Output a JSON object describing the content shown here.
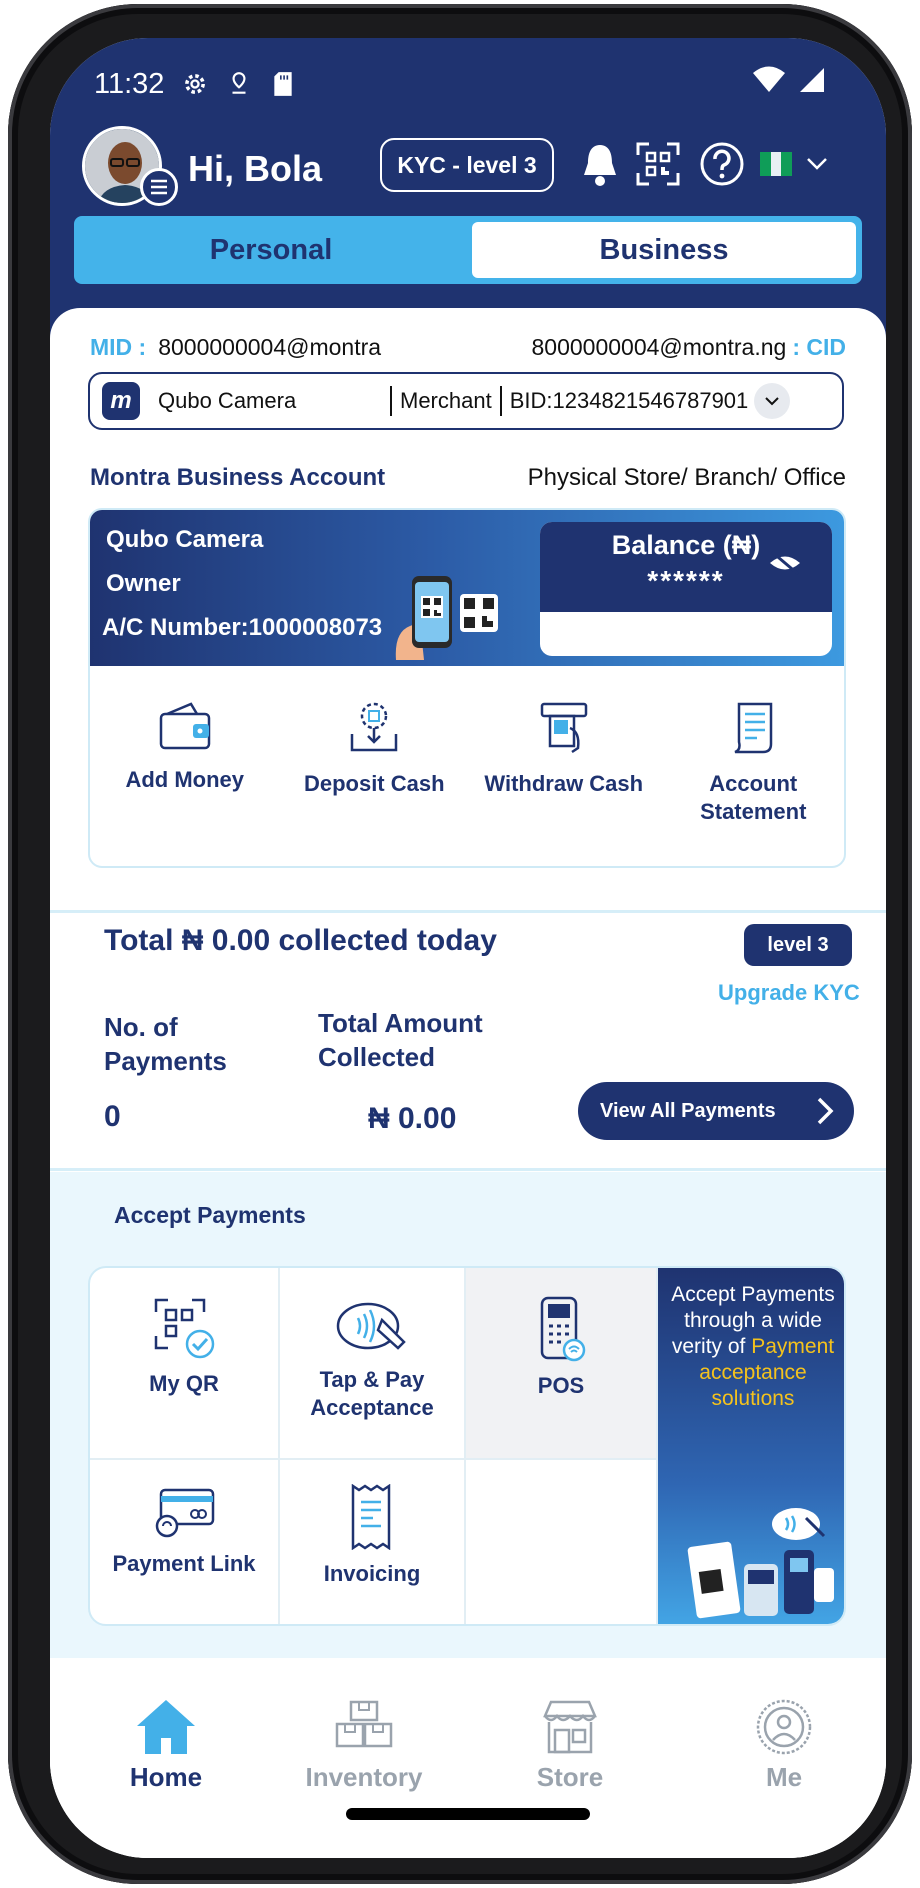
{
  "status_bar": {
    "time": "11:32",
    "icons": [
      "gear-icon",
      "location-icon",
      "sd-card-icon",
      "wifi-icon",
      "signal-icon"
    ]
  },
  "header": {
    "greeting": "Hi, Bola",
    "kyc_pill": "KYC -  level 3",
    "icons": [
      "bell-icon",
      "scan-qr-icon",
      "help-icon",
      "nigeria-flag-icon",
      "chevron-down-icon"
    ]
  },
  "account_toggle": {
    "personal": "Personal",
    "business": "Business",
    "selected": "Business"
  },
  "ids": {
    "mid_label": "MID :",
    "mid_value": "8000000004@montra",
    "cid_value": "8000000004@montra.ng",
    "cid_label": ": CID"
  },
  "merchant_selector": {
    "name": "Qubo Camera",
    "role": "Merchant",
    "bid": "BID:1234821546787901"
  },
  "account_section": {
    "title": "Montra Business Account",
    "location_type": "Physical Store/ Branch/ Office",
    "business_name": "Qubo Camera",
    "role": "Owner",
    "account_number": "A/C Number:1000008073",
    "balance_label": "Balance (₦)",
    "balance_value": "******",
    "actions": [
      {
        "label": "Add Money",
        "icon": "wallet-icon"
      },
      {
        "label": "Deposit Cash",
        "icon": "deposit-cash-icon"
      },
      {
        "label": "Withdraw Cash",
        "icon": "atm-withdraw-icon"
      },
      {
        "label": "Account Statement",
        "icon": "statement-icon"
      }
    ]
  },
  "collections": {
    "title": "Total ₦ 0.00 collected today",
    "level_badge": "level 3",
    "upgrade_link": "Upgrade KYC",
    "payments_label": "No. of Payments",
    "amount_label": "Total Amount Collected",
    "payments_value": "0",
    "amount_value": "₦ 0.00",
    "view_all": "View All Payments"
  },
  "accept_payments": {
    "title": "Accept Payments",
    "items": [
      {
        "label": "My QR",
        "icon": "qr-check-icon"
      },
      {
        "label": "Tap & Pay Acceptance",
        "icon": "tap-pay-icon"
      },
      {
        "label": "POS",
        "icon": "pos-terminal-icon"
      },
      {
        "label": "Payment Link",
        "icon": "payment-link-icon"
      },
      {
        "label": "Invoicing",
        "icon": "invoice-icon"
      }
    ],
    "promo_text": "Accept Payments through a wide verity of",
    "promo_highlight": "Payment acceptance solutions"
  },
  "bottom_nav": [
    {
      "label": "Home",
      "icon": "home-icon",
      "active": true
    },
    {
      "label": "Inventory",
      "icon": "boxes-icon",
      "active": false
    },
    {
      "label": "Store",
      "icon": "store-icon",
      "active": false
    },
    {
      "label": "Me",
      "icon": "profile-icon",
      "active": false
    }
  ],
  "colors": {
    "navy": "#1f3370",
    "sky": "#43b0e8",
    "highlight": "#f4c21d"
  }
}
